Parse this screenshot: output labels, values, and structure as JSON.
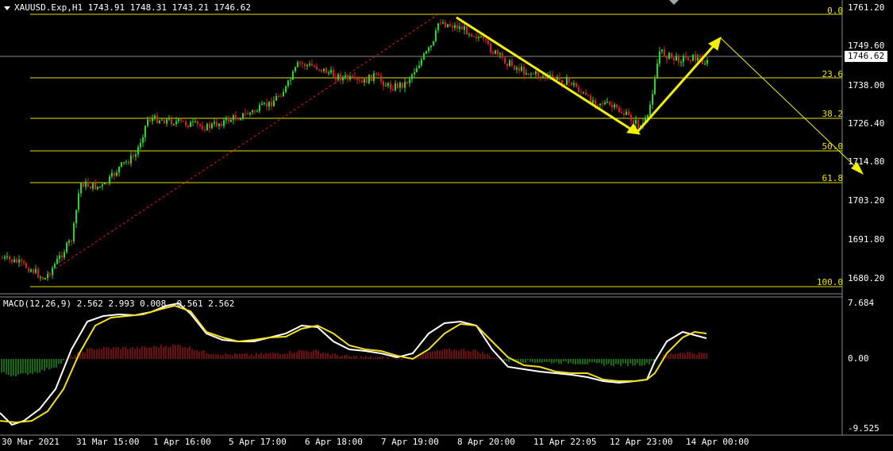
{
  "header": {
    "symbol_line": "XAUUSD.Exp,H1  1743.91 1748.31 1743.21 1746.62",
    "macd_line": "MACD(12,26,9) 2.562 2.993 0.008 -0.561 2.562"
  },
  "price_axis": {
    "ticks": [
      "1761.20",
      "1749.60",
      "1738.00",
      "1726.40",
      "1714.80",
      "1703.20",
      "1691.80",
      "1680.20"
    ],
    "current_price": "1746.62"
  },
  "macd_axis": {
    "ticks": [
      "7.684",
      "0.00",
      "-9.525"
    ]
  },
  "fibonacci": {
    "levels": [
      "0.0",
      "23.6",
      "38.2",
      "50.0",
      "61.8",
      "100.0"
    ],
    "color": "#e8e000"
  },
  "time_axis": {
    "labels": [
      "30 Mar 2021",
      "31 Mar 15:00",
      "1 Apr 16:00",
      "5 Apr 17:00",
      "6 Apr 18:00",
      "7 Apr 19:00",
      "8 Apr 20:00",
      "11 Apr 22:05",
      "12 Apr 23:00",
      "14 Apr 00:00"
    ]
  },
  "colors": {
    "bull": "#2bd42b",
    "bear": "#d42020",
    "macd_main": "#ffffff",
    "macd_signal": "#f0e020",
    "arrows": "#f0f000"
  }
}
